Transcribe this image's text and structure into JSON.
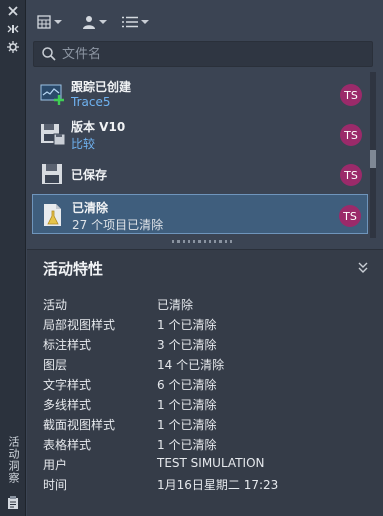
{
  "palette": {
    "vertical_title": "活动洞察"
  },
  "search": {
    "placeholder": "文件名",
    "value": ""
  },
  "changes": [
    {
      "title": "跟踪已创建",
      "subtitle": "Trace5",
      "subtitle_is_link": true,
      "avatar": "TS",
      "icon": "trace-created-icon"
    },
    {
      "title": "版本 V10",
      "subtitle": "比较",
      "subtitle_is_link": true,
      "avatar": "TS",
      "icon": "version-save-icon"
    },
    {
      "title": "已保存",
      "subtitle": "",
      "subtitle_is_link": false,
      "avatar": "TS",
      "icon": "save-icon"
    },
    {
      "title": "已清除",
      "subtitle": "27 个项目已清除",
      "subtitle_is_link": false,
      "avatar": "TS",
      "icon": "purge-icon",
      "selected": true
    }
  ],
  "properties": {
    "heading": "活动特性",
    "rows": [
      {
        "key": "活动",
        "value": "已清除"
      },
      {
        "key": "局部视图样式",
        "value": "1 个已清除"
      },
      {
        "key": "标注样式",
        "value": "3 个已清除"
      },
      {
        "key": "图层",
        "value": "14 个已清除"
      },
      {
        "key": "文字样式",
        "value": "6 个已清除"
      },
      {
        "key": "多线样式",
        "value": "1 个已清除"
      },
      {
        "key": "截面视图样式",
        "value": "1 个已清除"
      },
      {
        "key": "表格样式",
        "value": "1 个已清除"
      },
      {
        "key": "用户",
        "value": "TEST SIMULATION"
      },
      {
        "key": "时间",
        "value": "1月16日星期二 17:23"
      }
    ]
  },
  "colors": {
    "panel_bg": "#3b4453",
    "selected_bg": "#3f5e7d",
    "link": "#6fb2f0",
    "avatar": "#9b2a6a"
  }
}
